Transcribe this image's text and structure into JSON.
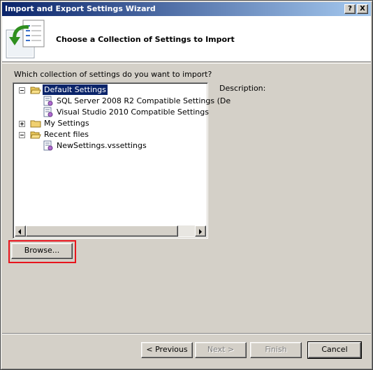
{
  "window": {
    "title": "Import and Export Settings Wizard",
    "help_glyph": "?",
    "close_glyph": "X"
  },
  "header": {
    "title": "Choose a Collection of Settings to Import",
    "icon": "import-settings-icon"
  },
  "main": {
    "question": "Which collection of settings do you want to import?",
    "description_label": "Description:"
  },
  "tree": {
    "nodes": [
      {
        "label": "Default Settings",
        "type": "folder",
        "expanded": true,
        "selected": true
      },
      {
        "label": "SQL Server 2008 R2 Compatible Settings (De",
        "type": "settings-file"
      },
      {
        "label": "Visual Studio 2010 Compatible Settings",
        "type": "settings-file"
      },
      {
        "label": "My Settings",
        "type": "folder",
        "expanded": false
      },
      {
        "label": "Recent files",
        "type": "folder",
        "expanded": true
      },
      {
        "label": "NewSettings.vssettings",
        "type": "settings-file"
      }
    ]
  },
  "buttons": {
    "browse": "Browse...",
    "previous": "< Previous",
    "next": "Next >",
    "finish": "Finish",
    "cancel": "Cancel"
  },
  "colors": {
    "titlebar_start": "#0a246a",
    "titlebar_end": "#a6caf0",
    "dialog_face": "#d4d0c8",
    "selection": "#0a246a",
    "highlight_box": "#e8141c"
  }
}
